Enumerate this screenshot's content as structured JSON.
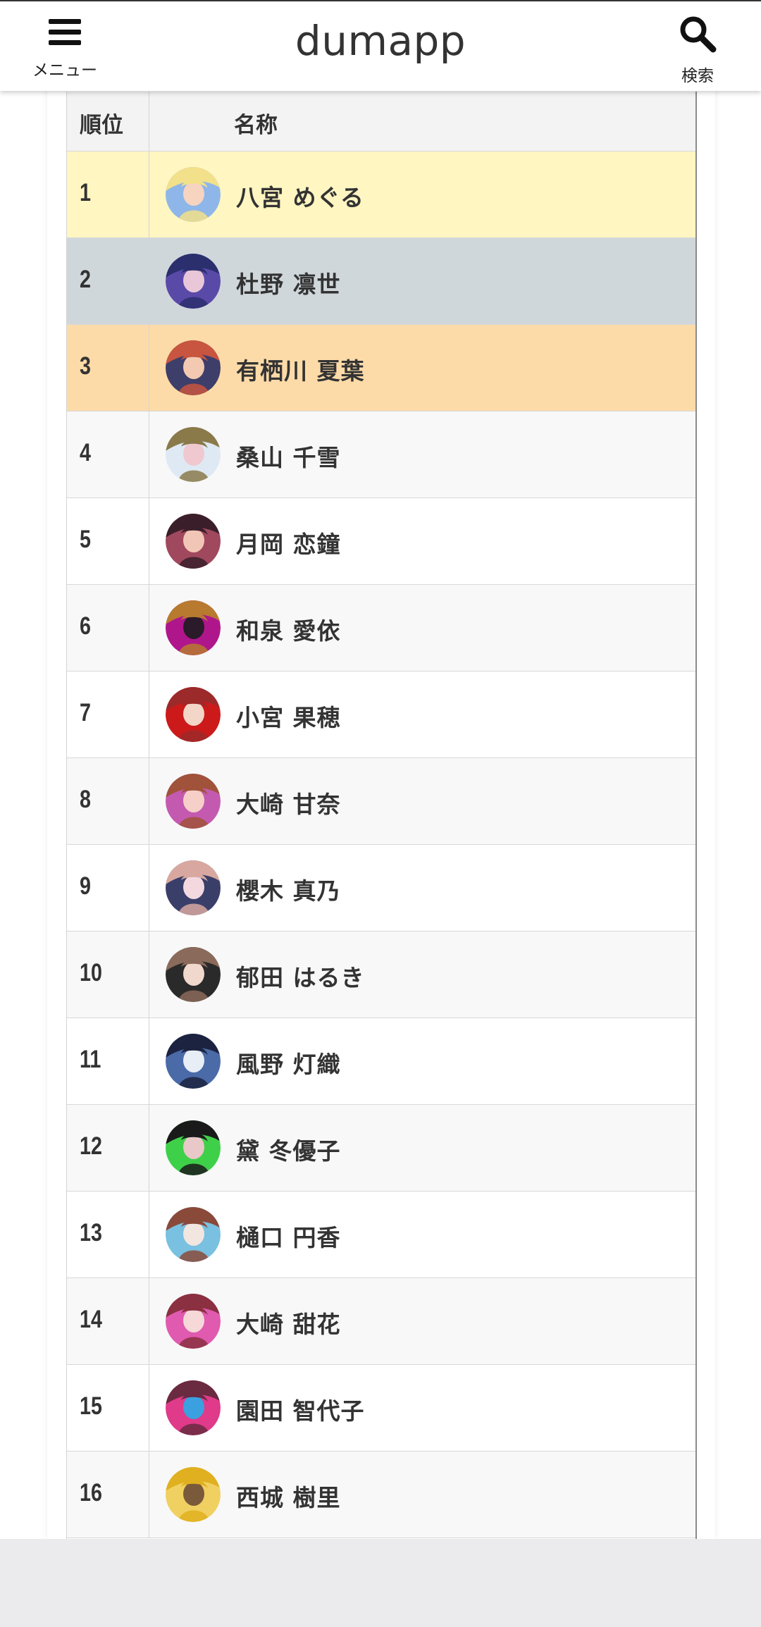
{
  "header": {
    "menu_label": "メニュー",
    "title": "dumapp",
    "search_label": "検索",
    "menu_icon": "hamburger-icon",
    "search_icon": "search-icon"
  },
  "table": {
    "columns": {
      "rank": "順位",
      "name": "名称"
    },
    "rows": [
      {
        "rank": "1",
        "name": "八宮 めぐる",
        "bg": "#fff6c2",
        "avatar_colors": [
          "#f2e08a",
          "#8fb6e8",
          "#f7d4c0"
        ]
      },
      {
        "rank": "2",
        "name": "杜野 凛世",
        "bg": "#d0d7db",
        "avatar_colors": [
          "#2b2f6e",
          "#5a4aa8",
          "#e9c7d8"
        ]
      },
      {
        "rank": "3",
        "name": "有栖川 夏葉",
        "bg": "#fddba8",
        "avatar_colors": [
          "#c8553f",
          "#3e3e6a",
          "#f3c9b2"
        ]
      },
      {
        "rank": "4",
        "name": "桑山 千雪",
        "bg": "#f8f8f8",
        "avatar_colors": [
          "#8a7a4a",
          "#dfe9f3",
          "#f0c8d0"
        ]
      },
      {
        "rank": "5",
        "name": "月岡 恋鐘",
        "bg": "#ffffff",
        "avatar_colors": [
          "#3a1f2a",
          "#a0485e",
          "#f2c6b6"
        ]
      },
      {
        "rank": "6",
        "name": "和泉 愛依",
        "bg": "#f8f8f8",
        "avatar_colors": [
          "#b77a2e",
          "#b0168c",
          "#2a1a2a"
        ]
      },
      {
        "rank": "7",
        "name": "小宮 果穂",
        "bg": "#ffffff",
        "avatar_colors": [
          "#9c2a2a",
          "#cc1a1a",
          "#f4d6c8"
        ]
      },
      {
        "rank": "8",
        "name": "大崎 甘奈",
        "bg": "#f8f8f8",
        "avatar_colors": [
          "#a0523a",
          "#c45ab0",
          "#f6d0c8"
        ]
      },
      {
        "rank": "9",
        "name": "櫻木 真乃",
        "bg": "#ffffff",
        "avatar_colors": [
          "#d8a8a0",
          "#3a3f6a",
          "#f3d8e0"
        ]
      },
      {
        "rank": "10",
        "name": "郁田 はるき",
        "bg": "#f8f8f8",
        "avatar_colors": [
          "#8a6a5a",
          "#2a2a2a",
          "#f0d8cc"
        ]
      },
      {
        "rank": "11",
        "name": "風野 灯織",
        "bg": "#ffffff",
        "avatar_colors": [
          "#1c2340",
          "#4a6aa8",
          "#e8eef6"
        ]
      },
      {
        "rank": "12",
        "name": "黛 冬優子",
        "bg": "#f8f8f8",
        "avatar_colors": [
          "#1a1a1a",
          "#3fd04a",
          "#e8c8c8"
        ]
      },
      {
        "rank": "13",
        "name": "樋口 円香",
        "bg": "#ffffff",
        "avatar_colors": [
          "#8a4a3a",
          "#7ac0e0",
          "#f2e6e0"
        ]
      },
      {
        "rank": "14",
        "name": "大崎 甜花",
        "bg": "#f8f8f8",
        "avatar_colors": [
          "#8a3040",
          "#e05ab0",
          "#f6d8d8"
        ]
      },
      {
        "rank": "15",
        "name": "園田 智代子",
        "bg": "#ffffff",
        "avatar_colors": [
          "#6a2a40",
          "#e03a8a",
          "#3aa0e0"
        ]
      },
      {
        "rank": "16",
        "name": "西城 樹里",
        "bg": "#f8f8f8",
        "avatar_colors": [
          "#e0b020",
          "#f0d060",
          "#7a5a3a"
        ]
      }
    ]
  }
}
